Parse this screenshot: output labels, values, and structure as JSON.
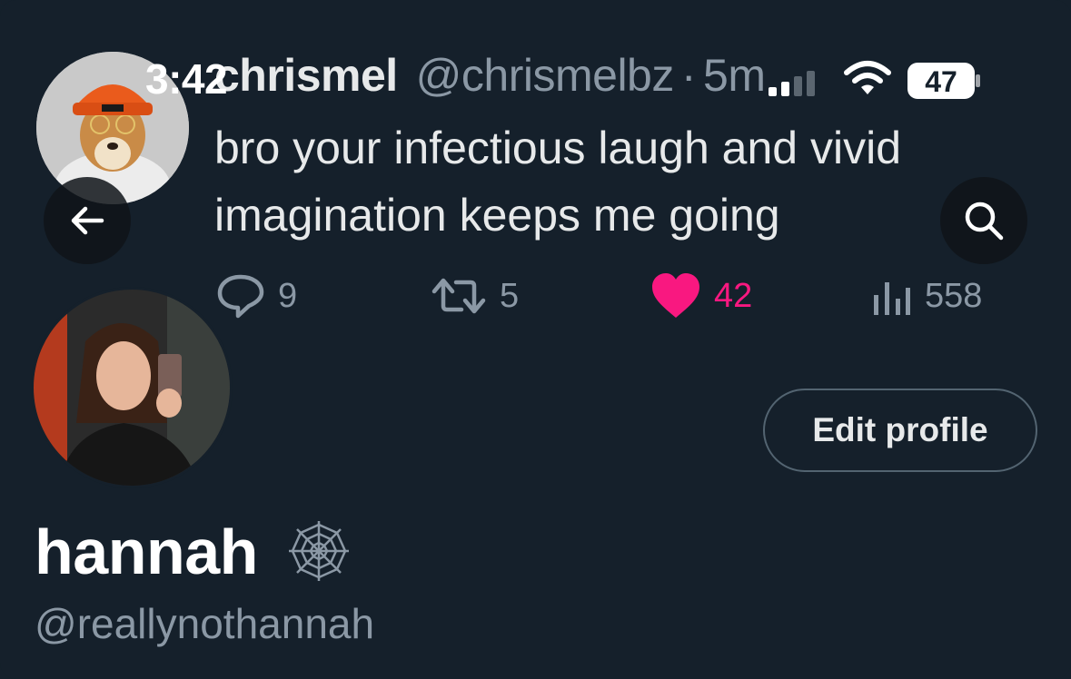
{
  "status_bar": {
    "time": "3:42",
    "battery": "47"
  },
  "tweet": {
    "display_name": "chrismel",
    "handle": "@chrismelbz",
    "separator": "·",
    "time": "5m",
    "text_line1": "bro your infectious laugh and vivid",
    "text_line2": "imagination keeps me going",
    "replies": "9",
    "retweets": "5",
    "likes": "42",
    "views": "558"
  },
  "profile": {
    "name": "hannah",
    "handle": "@reallynothannah",
    "edit_label": "Edit profile"
  },
  "icons": {
    "back": "arrow-left-icon",
    "search": "search-icon",
    "reply": "reply-bubble-icon",
    "retweet": "retweet-icon",
    "like": "heart-icon",
    "views": "bar-chart-icon",
    "badge": "spider-web-icon"
  },
  "colors": {
    "background": "#15202b",
    "like": "#f91880",
    "muted": "#8b98a5",
    "text": "#e7e9ea"
  }
}
